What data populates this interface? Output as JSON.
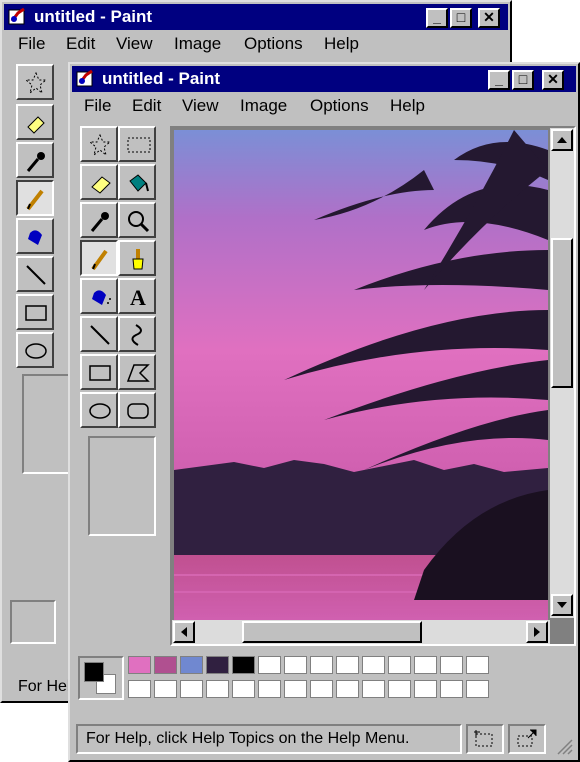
{
  "back_window": {
    "title": "untitled - Paint",
    "menu": [
      "File",
      "Edit",
      "View",
      "Image",
      "Options",
      "Help"
    ],
    "status_text": "For Help"
  },
  "front_window": {
    "title": "untitled - Paint",
    "menu": [
      "File",
      "Edit",
      "View",
      "Image",
      "Options",
      "Help"
    ],
    "tools": [
      "free-form-select",
      "select",
      "eraser",
      "fill-with-color",
      "pick-color",
      "magnifier",
      "pencil",
      "brush",
      "airbrush",
      "text",
      "line",
      "curve",
      "rectangle",
      "polygon",
      "ellipse",
      "rounded-rectangle"
    ],
    "selected_tool": "pencil",
    "palette": {
      "foreground": "#000000",
      "background": "#ffffff",
      "top_row": [
        "#e070c0",
        "#b05090",
        "#7088d0",
        "#302040",
        "#000000",
        "#ffffff",
        "#ffffff",
        "#ffffff",
        "#ffffff",
        "#ffffff",
        "#ffffff",
        "#ffffff",
        "#ffffff",
        "#ffffff"
      ],
      "bottom_row": [
        "#ffffff",
        "#ffffff",
        "#ffffff",
        "#ffffff",
        "#ffffff",
        "#ffffff",
        "#ffffff",
        "#ffffff",
        "#ffffff",
        "#ffffff",
        "#ffffff",
        "#ffffff",
        "#ffffff",
        "#ffffff"
      ]
    },
    "status_text": "For Help, click Help Topics on the Help Menu."
  },
  "canvas": {
    "scene": "palm-tree-sunset",
    "sky_colors": [
      "#7b8fd6",
      "#c070c8",
      "#e070c0",
      "#d060b0"
    ],
    "mountain_color": "#302040",
    "water_color": "#c05090"
  }
}
